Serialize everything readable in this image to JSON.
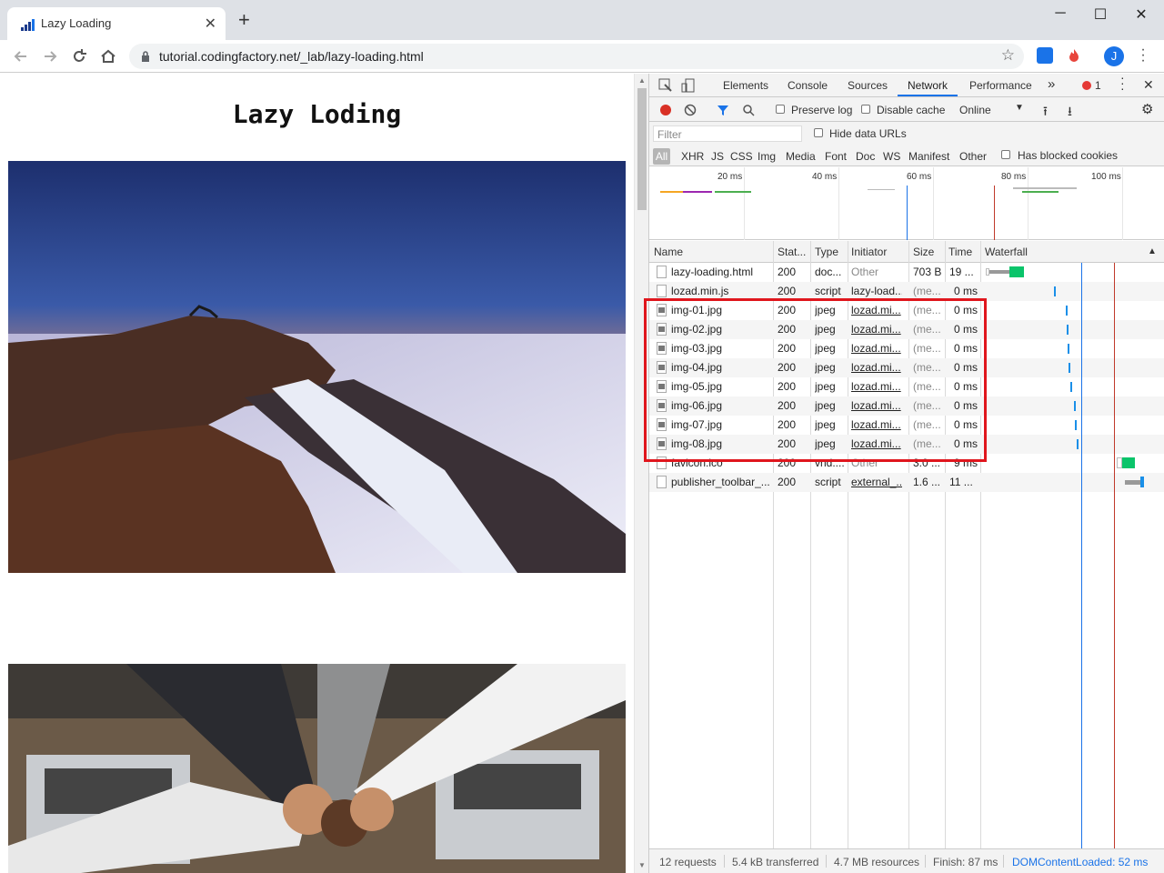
{
  "tab": {
    "title": "Lazy Loading",
    "close": "✕"
  },
  "newtab": "+",
  "window": {
    "minimize": "─",
    "maximize": "☐",
    "close": "✕"
  },
  "toolbar": {
    "url": "tutorial.codingfactory.net/_lab/lazy-loading.html",
    "profile_initial": "J"
  },
  "page": {
    "heading": "Lazy Loding"
  },
  "devtools": {
    "tabs": [
      "Elements",
      "Console",
      "Sources",
      "Network",
      "Performance"
    ],
    "active_tab": "Network",
    "more": "»",
    "error_count": "1",
    "toolbar": {
      "preserve_log": "Preserve log",
      "disable_cache": "Disable cache",
      "throttle": "Online"
    },
    "filter_placeholder": "Filter",
    "hide_data_urls": "Hide data URLs",
    "type_filters": [
      "All",
      "XHR",
      "JS",
      "CSS",
      "Img",
      "Media",
      "Font",
      "Doc",
      "WS",
      "Manifest",
      "Other"
    ],
    "has_blocked_cookies": "Has blocked cookies",
    "overview_ticks": [
      "20 ms",
      "40 ms",
      "60 ms",
      "80 ms",
      "100 ms"
    ],
    "columns": [
      "Name",
      "Stat...",
      "Type",
      "Initiator",
      "Size",
      "Time",
      "Waterfall"
    ],
    "rows": [
      {
        "name": "lazy-loading.html",
        "status": "200",
        "type": "doc...",
        "initiator": "Other",
        "size": "703 B",
        "time": "19 ..."
      },
      {
        "name": "lozad.min.js",
        "status": "200",
        "type": "script",
        "initiator": "lazy-load...",
        "size": "(me...",
        "time": "0 ms"
      },
      {
        "name": "img-01.jpg",
        "status": "200",
        "type": "jpeg",
        "initiator": "lozad.mi...",
        "size": "(me...",
        "time": "0 ms"
      },
      {
        "name": "img-02.jpg",
        "status": "200",
        "type": "jpeg",
        "initiator": "lozad.mi...",
        "size": "(me...",
        "time": "0 ms"
      },
      {
        "name": "img-03.jpg",
        "status": "200",
        "type": "jpeg",
        "initiator": "lozad.mi...",
        "size": "(me...",
        "time": "0 ms"
      },
      {
        "name": "img-04.jpg",
        "status": "200",
        "type": "jpeg",
        "initiator": "lozad.mi...",
        "size": "(me...",
        "time": "0 ms"
      },
      {
        "name": "img-05.jpg",
        "status": "200",
        "type": "jpeg",
        "initiator": "lozad.mi...",
        "size": "(me...",
        "time": "0 ms"
      },
      {
        "name": "img-06.jpg",
        "status": "200",
        "type": "jpeg",
        "initiator": "lozad.mi...",
        "size": "(me...",
        "time": "0 ms"
      },
      {
        "name": "img-07.jpg",
        "status": "200",
        "type": "jpeg",
        "initiator": "lozad.mi...",
        "size": "(me...",
        "time": "0 ms"
      },
      {
        "name": "img-08.jpg",
        "status": "200",
        "type": "jpeg",
        "initiator": "lozad.mi...",
        "size": "(me...",
        "time": "0 ms"
      },
      {
        "name": "favicon.ico",
        "status": "200",
        "type": "vnd....",
        "initiator": "Other",
        "size": "3.0 ...",
        "time": "9 ms"
      },
      {
        "name": "publisher_toolbar_...",
        "status": "200",
        "type": "script",
        "initiator": "external_...",
        "size": "1.6 ...",
        "time": "11 ..."
      }
    ],
    "status": {
      "requests": "12 requests",
      "transferred": "5.4 kB transferred",
      "resources": "4.7 MB resources",
      "finish": "Finish: 87 ms",
      "dcl": "DOMContentLoaded: 52 ms"
    }
  },
  "colors": {
    "highlight": "#e0161d",
    "accent": "#1a73e8",
    "dcl_line": "#1a73e8",
    "load_line": "#c0392b"
  }
}
